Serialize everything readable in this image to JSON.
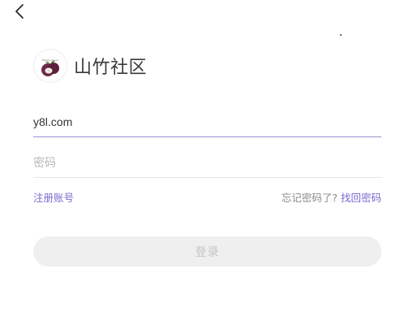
{
  "header": {
    "back_icon": "chevron-left-icon"
  },
  "brand": {
    "logo_icon": "mangosteen-logo-icon",
    "logo_caption": "Mangosteen",
    "title": "山竹社区"
  },
  "form": {
    "username_value": "y8l.com",
    "password_placeholder": "密码",
    "register_link": "注册账号",
    "forgot_prompt": "忘记密码了?",
    "recover_link": "找回密码",
    "login_button": "登录"
  },
  "colors": {
    "accent": "#7a69d1",
    "active_underline": "#9a8fd3",
    "button_bg": "#efefef",
    "button_text": "#c4c4c4"
  }
}
